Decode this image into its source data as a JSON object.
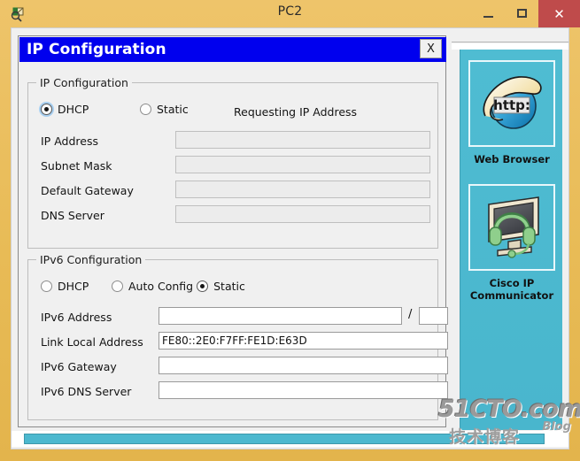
{
  "window": {
    "title": "PC2",
    "icon": "magnifier-tag-icon",
    "minimize_label": "–",
    "maximize_label": "□",
    "close_label": "✕"
  },
  "dialog": {
    "title": "IP Configuration",
    "close_label": "X"
  },
  "ipv4": {
    "group_label": "IP Configuration",
    "modes": [
      {
        "label": "DHCP",
        "selected": true
      },
      {
        "label": "Static",
        "selected": false
      }
    ],
    "status": "Requesting IP Address",
    "fields": [
      {
        "label": "IP Address",
        "value": "",
        "enabled": false
      },
      {
        "label": "Subnet Mask",
        "value": "",
        "enabled": false
      },
      {
        "label": "Default Gateway",
        "value": "",
        "enabled": false
      },
      {
        "label": "DNS Server",
        "value": "",
        "enabled": false
      }
    ]
  },
  "ipv6": {
    "group_label": "IPv6 Configuration",
    "modes": [
      {
        "label": "DHCP",
        "selected": false
      },
      {
        "label": "Auto Config",
        "selected": false
      },
      {
        "label": "Static",
        "selected": true
      }
    ],
    "address_label": "IPv6 Address",
    "address_value": "",
    "prefix_separator": "/",
    "prefix_value": "",
    "fields": [
      {
        "label": "Link Local Address",
        "value": "FE80::2E0:F7FF:FE1D:E63D"
      },
      {
        "label": "IPv6 Gateway",
        "value": ""
      },
      {
        "label": "IPv6 DNS Server",
        "value": ""
      }
    ]
  },
  "sidebar": {
    "apps": [
      {
        "name": "Web Browser",
        "icon": "http-globe-icon"
      },
      {
        "name": "Cisco IP Communicator",
        "icon": "monitor-headset-icon"
      }
    ]
  },
  "watermark": {
    "main": "51CTO.com",
    "cn": "技术博客",
    "blog": "Blog"
  },
  "colors": {
    "window_chrome": "#e8b84f",
    "dialog_titlebar": "#0000ee",
    "sidebar": "#4cb8cf",
    "close_button": "#bf4b4b",
    "scrollbar_thumb": "#4cb8cf"
  }
}
